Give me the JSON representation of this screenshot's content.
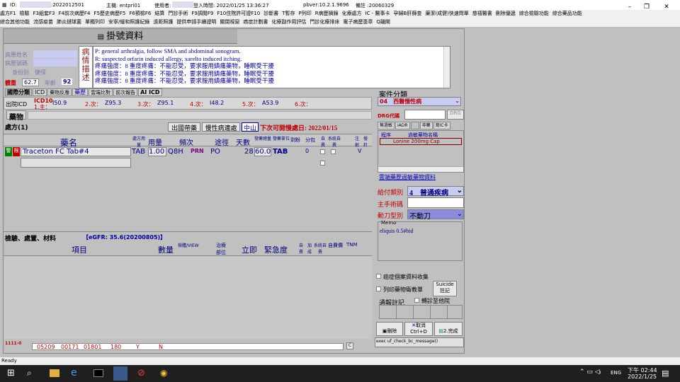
{
  "titlebar": {
    "id": "ID:",
    "id2": ":2022012501",
    "host": "主機: entpri01",
    "user": "使用者:",
    "login": "登入時間: 2022/01/25 13:36:27",
    "pbver": "pbver:10.2.1.9696",
    "memo": "備註 :20060329"
  },
  "menu1": [
    "處方F1",
    "檢驗",
    "F3組套F3",
    "F4前次病歷F4",
    "F5歷史病歷F5",
    "F6預檢F6",
    "結算",
    "門診手術",
    "F9調閱F9",
    "F10住院許可證F10",
    "診斷書",
    "T暫存",
    "P列印",
    "R病歷摘錄",
    "化療處方",
    "IC - 醫事卡",
    "孕婦B肝篩查",
    "廉潔(成健)快速問單",
    "慈禧醫書",
    "刪除優遞",
    "綜合檢驗功能",
    "綜合藥品功能"
  ],
  "menu2": [
    "綜合其他功能",
    "流感疫苗",
    "肺炎鏈球菌",
    "單獨列印",
    "安寧/緩和照護紀錄",
    "遠距照護",
    "提供申請手續證明",
    "關閉視窗",
    "癌症計劃書",
    "化療副作用評估",
    "門診化療排床",
    "電子病歷簽章",
    "Q離開"
  ],
  "header": {
    "title": "掛號資料"
  },
  "patient": {
    "name_label": "病患姓名",
    "chart_label": "病歷號碼",
    "id_label": "身份別",
    "id_value": "健保",
    "weight_label": "體重",
    "weight": "62.7",
    "age_label": "年齡",
    "age": "92"
  },
  "disease": {
    "label": "病情描述",
    "lines": [
      "P: general arthralgia, follow SMA and abdominal sonogram.",
      "R: suspected orfarin induced allergy, xarelto induced itching.",
      "疼痛強度：8 重度疼痛：不能忍受，要求服用鎮痛藥物，睡眠受干擾",
      "疼痛強度：8 重度疼痛：不能忍受，要求服用鎮痛藥物，睡眠受干擾",
      "疼痛強度：8 重度疼痛：不能忍受，要求服用鎮痛藥物，睡眠受干擾"
    ]
  },
  "tabs": [
    "國際分類",
    "ICD",
    "藥物反應",
    "藥歷",
    "雲端比對",
    "前次報告",
    "AI ICD"
  ],
  "icd": {
    "out_label": "出院ICD",
    "icd10": "ICD10",
    "main_label": "1.主：",
    "main": "I50.9",
    "c2": "Z95.3",
    "c3": "Z95.1",
    "c4": "I48.2",
    "c5": "A53.9",
    "l2": "2.次：",
    "l3": "3.次：",
    "l4": "4.次：",
    "l5": "5.次：",
    "l6": "6.次："
  },
  "drug_label": "藥物",
  "rx": {
    "title": "處方(1)",
    "btn1": "出國帶藥",
    "btn2": "慢性病連處",
    "btn3": "中山",
    "next": "下次可開慢處日: 2022/01/15",
    "cols": [
      "藥名",
      "處方用量",
      "用量",
      "頻次",
      "途徑",
      "天數",
      "發藥總量",
      "發藥單位",
      "劑粉",
      "分包",
      "自費",
      "系統自費",
      "注射",
      "慢針"
    ],
    "row": {
      "flag1": "警",
      "flag2": "限",
      "name": "Traceton FC Tab#4",
      "unit": "TAB",
      "dose": "1.00",
      "freq": "Q8H",
      "prn": "PRN",
      "route": "PO",
      "days": "28",
      "total": "60.0",
      "dunit": "TAB",
      "pow": "0"
    }
  },
  "exam": {
    "title": "檢驗、處置、材料",
    "egfr": "【eGFR: 35.6(20200805)】",
    "cols": [
      "項目",
      "數量",
      "檢體/VIEW",
      "治療部位",
      "立即",
      "緊急度",
      "自費",
      "加成",
      "系統自費",
      "自費價",
      "TNM"
    ]
  },
  "bottom": {
    "code": "1111-0",
    "cells": [
      "05209",
      "00171",
      "01801",
      "180",
      "Y",
      "N"
    ],
    "c": "C"
  },
  "right": {
    "case_label": "案件分類",
    "case_value": "04　西醫慢性病",
    "drg_label": "DRG代碼",
    "drg_btn": "DRG",
    "tabs": [
      "無過敏",
      "iADR",
      "",
      "非藥",
      "寫IC卡"
    ],
    "allergy_cols": [
      "程序",
      "過敏藥物名稱"
    ],
    "allergy_item": "Lonine 200mg Cap",
    "cloud": "雲端藥歷過敏藥物資料",
    "pay_label": "給付類別",
    "pay_value": "4　普通疾病",
    "op_label": "主手術碼",
    "knife_label": "動刀型別",
    "knife_value": "不動刀",
    "memo_label": "Memo",
    "memo": "eliquis 0.5#bid",
    "cb1": "癌症個案資料收集",
    "cb2": "列印藥物衛教單",
    "suicide": "Suicide註記",
    "report_label": "通報註記",
    "cb3": "轉診至他院",
    "b_del": "刪除",
    "b_cancel": "取消",
    "b_cancel2": "Ctrl+D",
    "b_save": "2.完成",
    "exec": "exec uf_check_bc_message()"
  },
  "status": "Ready",
  "clock": {
    "time": "下午 02:44",
    "date": "2022/1/25",
    "ime": "ENG"
  }
}
